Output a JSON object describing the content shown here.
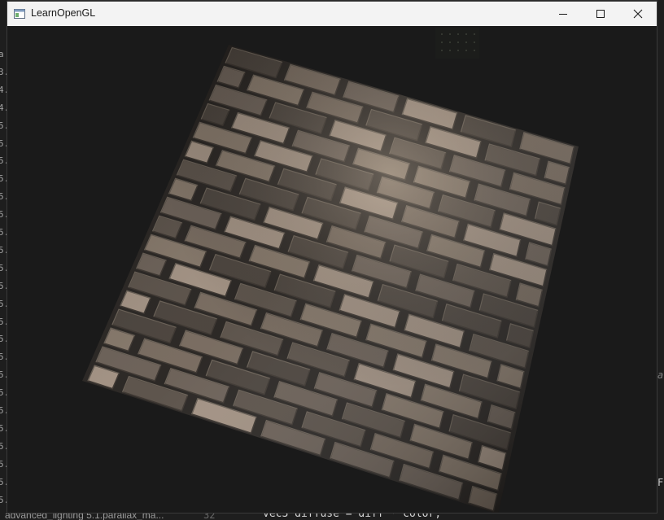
{
  "window": {
    "title": "LearnOpenGL",
    "controls": [
      "minimize",
      "maximize",
      "close"
    ]
  },
  "background_editor": {
    "gutter_prefix": [
      "a",
      "3.",
      "4.",
      "4.",
      "5.",
      "5.",
      "5.",
      "5.",
      "5.",
      "5.",
      "5.",
      "5.",
      "5.",
      "5.",
      "5.",
      "5.",
      "5.",
      "5.",
      "5.",
      "5.",
      "5.",
      "5.",
      "5.",
      "5.",
      "5.",
      "5.",
      "5.",
      "5."
    ],
    "bottom_tab": "advanced_lighting  5.1.parallax_ma...",
    "bottom_line_number": "32",
    "bottom_code": "vec3 diffuse = diff * color;",
    "right_glyph_top": "a",
    "right_glyph_bottom": "F"
  },
  "scene": {
    "object": "brick-wall-plane",
    "light_cube": "small-dark-cube",
    "colors": {
      "clear": "#1a1a1a",
      "brick_light": "#9a8878",
      "brick_mid": "#5e5248",
      "brick_dark": "#3a322b",
      "mortar": "#15110e"
    }
  }
}
